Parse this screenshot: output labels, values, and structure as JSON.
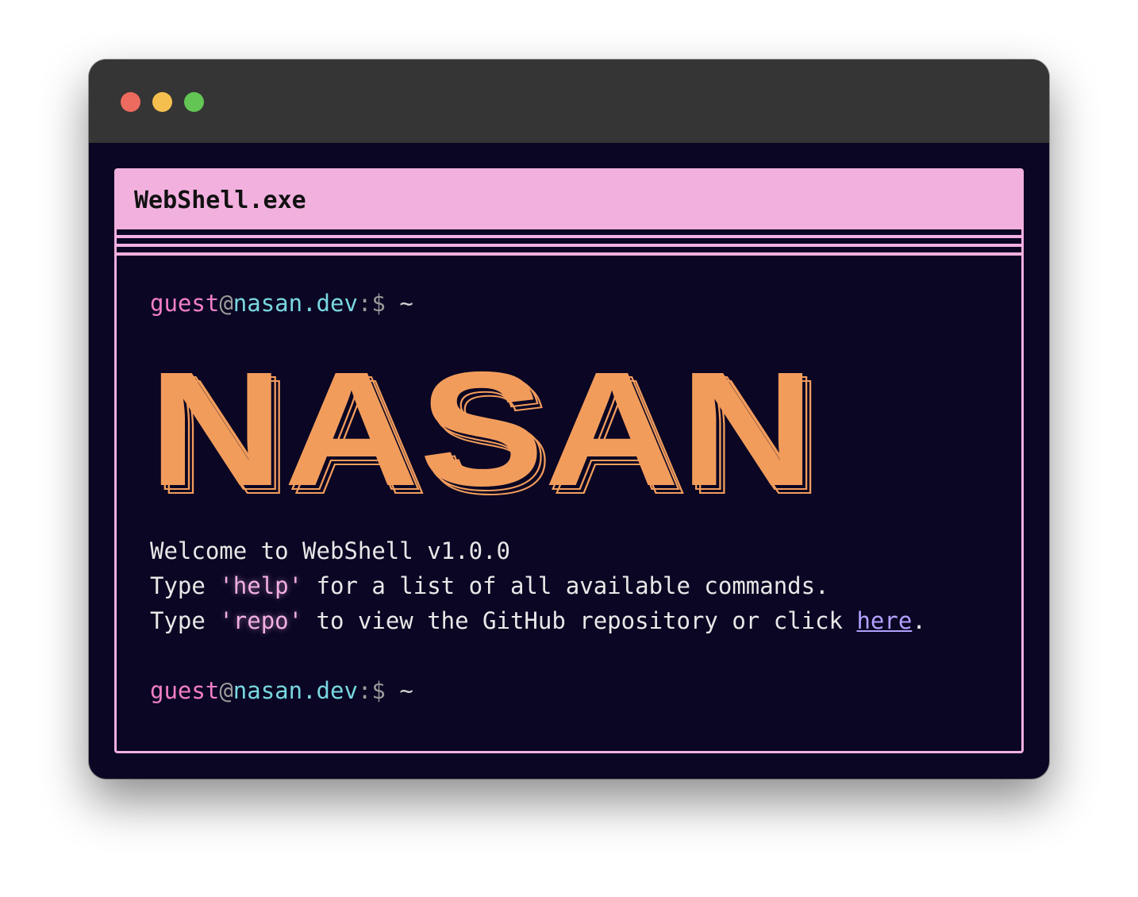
{
  "window": {
    "traffic_lights": {
      "close_color": "#ed6a5e",
      "minimize_color": "#f5bf4f",
      "maximize_color": "#62c554"
    }
  },
  "shell": {
    "title": "WebShell.exe",
    "accent_color": "#f2b0df",
    "banner_text": "NASAN",
    "banner_color": "#f29c5c",
    "prompt": {
      "user": "guest",
      "at": "@",
      "host": "nasan.dev",
      "separator": ":$",
      "path": "~"
    },
    "welcome": {
      "line1": "Welcome to WebShell v1.0.0",
      "line2_pre": "Type ",
      "line2_kw": "'help'",
      "line2_post": " for a list of all available commands.",
      "line3_pre": "Type ",
      "line3_kw": "'repo'",
      "line3_mid": " to view the GitHub repository or click ",
      "line3_link": "here",
      "line3_end": "."
    }
  }
}
